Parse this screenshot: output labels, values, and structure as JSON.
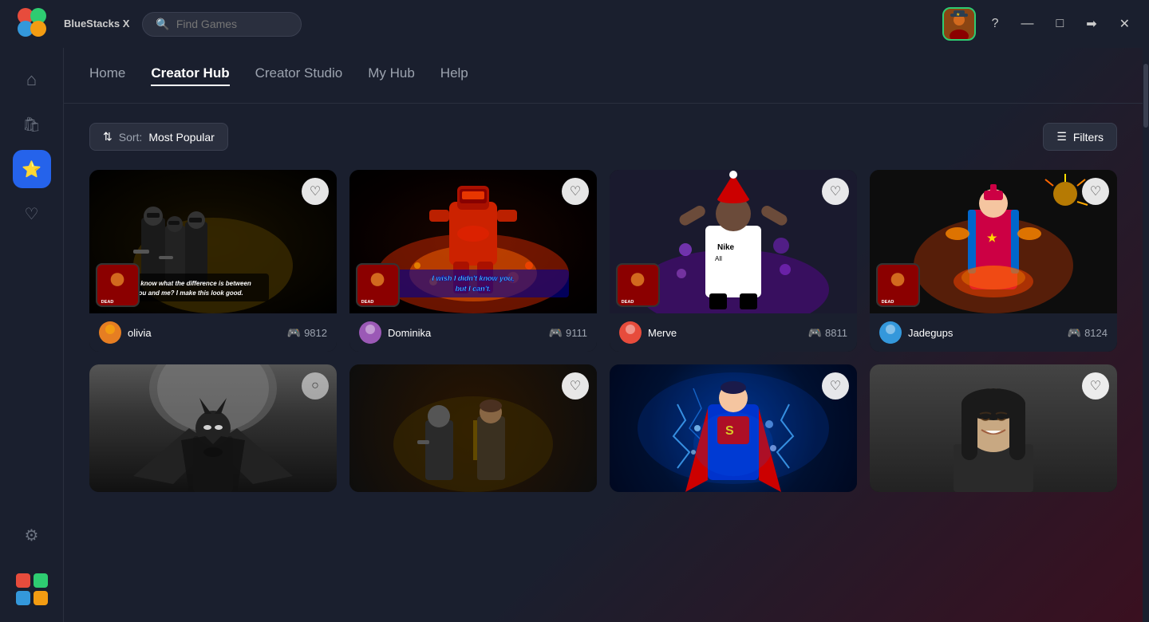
{
  "app": {
    "name": "BlueStacks X",
    "logo_text": "BlueStacks X"
  },
  "titlebar": {
    "search_placeholder": "Find Games",
    "help_icon": "?",
    "minimize_icon": "—",
    "maximize_icon": "□",
    "forward_icon": "→",
    "close_icon": "✕"
  },
  "sidebar": {
    "items": [
      {
        "id": "home",
        "icon": "⌂",
        "label": "Home"
      },
      {
        "id": "shop",
        "icon": "🛍",
        "label": "Shop"
      },
      {
        "id": "creator",
        "icon": "★",
        "label": "Creator",
        "active": true
      },
      {
        "id": "favorites",
        "icon": "♡",
        "label": "Favorites"
      },
      {
        "id": "settings",
        "icon": "⚙",
        "label": "Settings"
      }
    ]
  },
  "nav": {
    "tabs": [
      {
        "id": "home",
        "label": "Home",
        "active": false
      },
      {
        "id": "creator-hub",
        "label": "Creator Hub",
        "active": true
      },
      {
        "id": "creator-studio",
        "label": "Creator Studio",
        "active": false
      },
      {
        "id": "my-hub",
        "label": "My Hub",
        "active": false
      },
      {
        "id": "help",
        "label": "Help",
        "active": false
      }
    ]
  },
  "toolbar": {
    "sort_label": "Sort:",
    "sort_value": "Most Popular",
    "filters_label": "Filters"
  },
  "cards": [
    {
      "id": 1,
      "type": "men-in-black",
      "overlay_text": "You know what the difference is between you and me? I make this look good.",
      "user": "olivia",
      "plays": "9812",
      "user_color": "#e67e22",
      "game_tag": "DEAD"
    },
    {
      "id": 2,
      "type": "red-soldier",
      "overlay_text": "I wish I didn't know you, but I can't.",
      "user": "Dominika",
      "plays": "9111",
      "user_color": "#9b59b6",
      "game_tag": "DEAD"
    },
    {
      "id": 3,
      "type": "soccer-player",
      "overlay_text": "",
      "user": "Merve",
      "plays": "8811",
      "user_color": "#e74c3c",
      "game_tag": "DEAD"
    },
    {
      "id": 4,
      "type": "captain-marvel",
      "overlay_text": "",
      "user": "Jadegups",
      "plays": "8124",
      "user_color": "#3498db",
      "game_tag": "DEAD"
    },
    {
      "id": 5,
      "type": "batman",
      "overlay_text": "",
      "user": "",
      "plays": "",
      "has_heart": false
    },
    {
      "id": 6,
      "type": "soldier2",
      "overlay_text": "",
      "user": "",
      "plays": "",
      "has_heart": true
    },
    {
      "id": 7,
      "type": "superman",
      "overlay_text": "",
      "user": "",
      "plays": "",
      "has_heart": true
    },
    {
      "id": 8,
      "type": "woman",
      "overlay_text": "",
      "user": "",
      "plays": "",
      "has_heart": true
    }
  ],
  "colors": {
    "bg_primary": "#1a1f2e",
    "bg_secondary": "#2a2f3e",
    "accent_green": "#2ecc71",
    "accent_blue": "#2563eb"
  }
}
